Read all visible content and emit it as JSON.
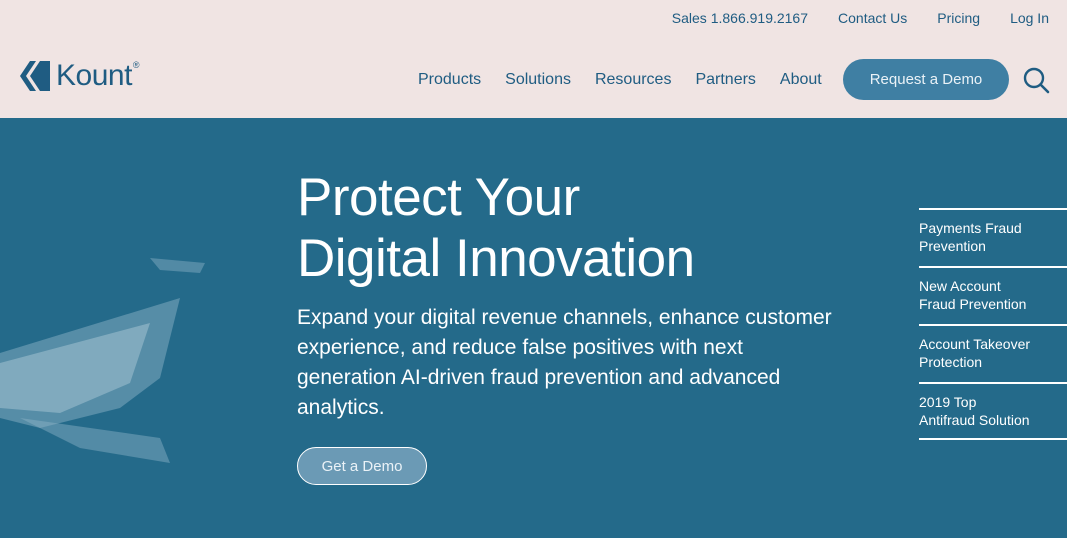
{
  "topbar": {
    "sales": "Sales 1.866.919.2167",
    "contact": "Contact Us",
    "pricing": "Pricing",
    "login": "Log In"
  },
  "logo": {
    "text": "Kount",
    "mark": "®"
  },
  "nav": {
    "items": [
      "Products",
      "Solutions",
      "Resources",
      "Partners",
      "About"
    ],
    "demo_button": "Request a Demo"
  },
  "hero": {
    "headline": [
      "Protect Your",
      "Digital Innovation"
    ],
    "subcopy": "Expand your digital revenue channels, enhance customer experience, and reduce false positives with next generation AI-driven fraud prevention and advanced analytics.",
    "cta": "Get a Demo"
  },
  "side_links": [
    [
      "Payments Fraud",
      "Prevention"
    ],
    [
      "New Account",
      "Fraud Prevention"
    ],
    [
      "Account Takeover",
      "Protection"
    ],
    [
      "2019 Top",
      "Antifraud Solution"
    ]
  ],
  "colors": {
    "header_bg": "#f0e4e3",
    "brand": "#1f5c82",
    "hero_bg": "#246a8a",
    "button": "#3f7fa3"
  },
  "icons": [
    "kount-logo-icon",
    "search-icon"
  ]
}
